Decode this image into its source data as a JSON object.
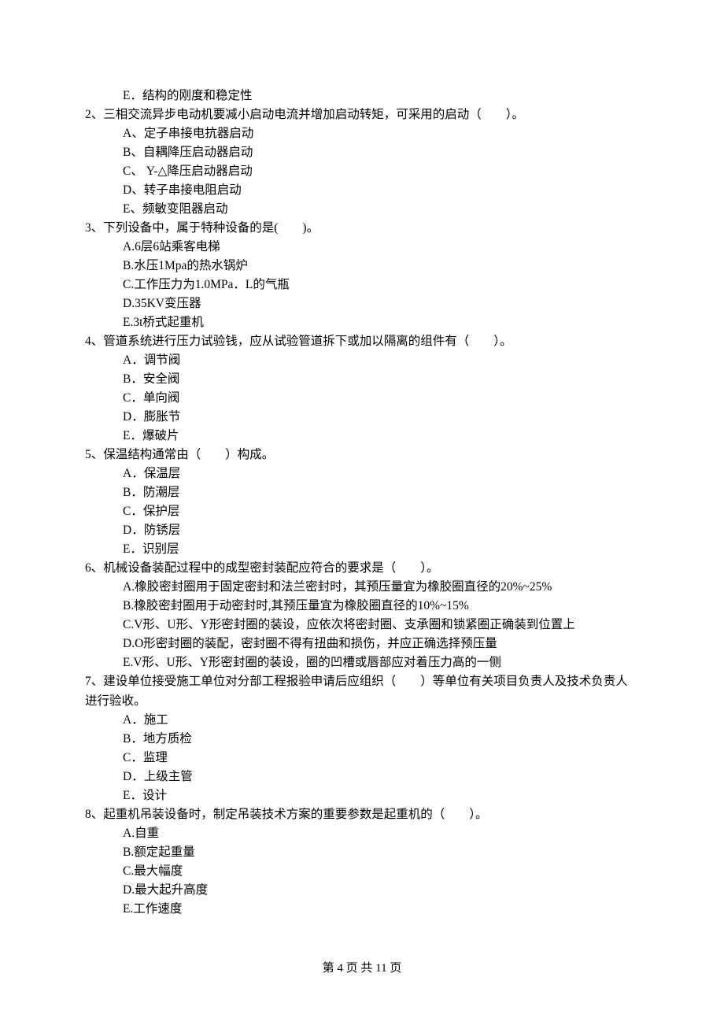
{
  "lead_e": "E．结构的刚度和稳定性",
  "q2": {
    "stem": "2、三相交流异步电动机要减小启动电流并增加启动转矩，可采用的启动（　　）。",
    "A": "A、定子串接电抗器启动",
    "B": "B、自耦降压启动器启动",
    "C": "C、 Y-△降压启动器启动",
    "D": "D、转子串接电阻启动",
    "E": "E、频敏变阻器启动"
  },
  "q3": {
    "stem": "3、下列设备中，属于特种设备的是(　　)。",
    "A": "A.6层6站乘客电梯",
    "B": "B.水压1Mpa的热水锅炉",
    "C": "C.工作压力为1.0MPa．L的气瓶",
    "D": "D.35KV变压器",
    "E": "E.3t桥式起重机"
  },
  "q4": {
    "stem": "4、管道系统进行压力试验钱，应从试验管道拆下或加以隔离的组件有（　　）。",
    "A": "A．调节阀",
    "B": "B．安全阀",
    "C": "C．单向阀",
    "D": "D．膨胀节",
    "E": "E．爆破片"
  },
  "q5": {
    "stem": "5、保温结构通常由（　　）构成。",
    "A": "A．保温层",
    "B": "B．防潮层",
    "C": "C．保护层",
    "D": "D．防锈层",
    "E": "E．识别层"
  },
  "q6": {
    "stem": "6、机械设备装配过程中的成型密封装配应符合的要求是（　　）。",
    "A": "A.橡胶密封圈用于固定密封和法兰密封时，其预压量宜为橡胶圈直径的20%~25%",
    "B": "B.橡胶密封圈用于动密封时,其预压量宜为橡胶圈直径的10%~15%",
    "C": "C.V形、U形、Y形密封圈的装设，应依次将密封圈、支承圈和锁紧圈正确装到位置上",
    "D": "D.O形密封圈的装配，密封圈不得有扭曲和损伤，并应正确选择预压量",
    "E": "E.V形、U形、Y形密封圈的装设，圈的凹槽或唇部应对着压力高的一侧"
  },
  "q7": {
    "stem": "7、建设单位接受施工单位对分部工程报验申请后应组织（　　）等单位有关项目负责人及技术负责人进行验收。",
    "A": "A．施工",
    "B": "B．地方质检",
    "C": "C．监理",
    "D": "D．上级主管",
    "E": "E．设计"
  },
  "q8": {
    "stem": "8、起重机吊装设备时，制定吊装技术方案的重要参数是起重机的（　　）。",
    "A": "A.自重",
    "B": "B.额定起重量",
    "C": "C.最大幅度",
    "D": "D.最大起升高度",
    "E": "E.工作速度"
  },
  "footer": "第 4 页 共 11 页"
}
